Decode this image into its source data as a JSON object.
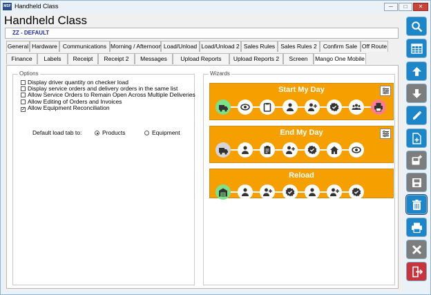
{
  "window": {
    "app_icon_text": "MSF",
    "title": "Handheld Class",
    "minimize": "─",
    "maximize": "□",
    "close": "✕"
  },
  "page": {
    "heading": "Handheld Class",
    "subheading": "ZZ - DEFAULT"
  },
  "tabs": {
    "row1": [
      "General",
      "Hardware",
      "Communications",
      "Morning / Afternoon",
      "Load/Unload",
      "Load/Unload 2",
      "Sales Rules",
      "Sales Rules 2",
      "Confirm Sale",
      "Off Route"
    ],
    "row2": [
      "Finance",
      "Labels",
      "Receipt",
      "Receipt 2",
      "Messages",
      "Upload Reports",
      "Upload Reports 2",
      "Screen",
      "Mango One Mobile"
    ],
    "active": "Mango One Mobile"
  },
  "options": {
    "label": "Options",
    "items": [
      {
        "label": "Display driver quantity on checker load",
        "checked": false
      },
      {
        "label": "Display service orders and delivery orders in the same list",
        "checked": false
      },
      {
        "label": "Allow Service Orders to Remain Open Across Multiple Deliveries",
        "checked": false
      },
      {
        "label": "Allow Editing of Orders and Invoices",
        "checked": false
      },
      {
        "label": "Allow Equipment Reconciliation",
        "checked": true
      }
    ],
    "load_tab_label": "Default load tab to:",
    "load_tab_options": [
      "Products",
      "Equipment"
    ],
    "load_tab_selected": "Products"
  },
  "wizards": {
    "label": "Wizards",
    "accent": "#f5a000",
    "items": [
      {
        "title": "Start My Day",
        "steps": [
          "truck-icon",
          "eye-icon",
          "clipboard-icon",
          "person-icon",
          "person-add-icon",
          "verified-icon",
          "group-icon",
          "printer-icon"
        ]
      },
      {
        "title": "End My Day",
        "steps": [
          "truck-icon",
          "person-icon",
          "clipboard-list-icon",
          "person-add-icon",
          "verified-icon",
          "home-icon",
          "eye-icon"
        ]
      },
      {
        "title": "Reload",
        "steps": [
          "warehouse-icon",
          "person-icon",
          "person-add-icon",
          "verified-icon",
          "person-icon",
          "person-add-icon",
          "verified-icon"
        ]
      }
    ]
  },
  "sidebar": {
    "buttons": [
      "search-icon",
      "table-icon",
      "arrow-up-icon",
      "arrow-down-icon",
      "pencil-icon",
      "new-document-icon",
      "add-save-icon",
      "save-icon",
      "trash-icon",
      "printer-icon",
      "close-icon",
      "exit-icon"
    ]
  }
}
